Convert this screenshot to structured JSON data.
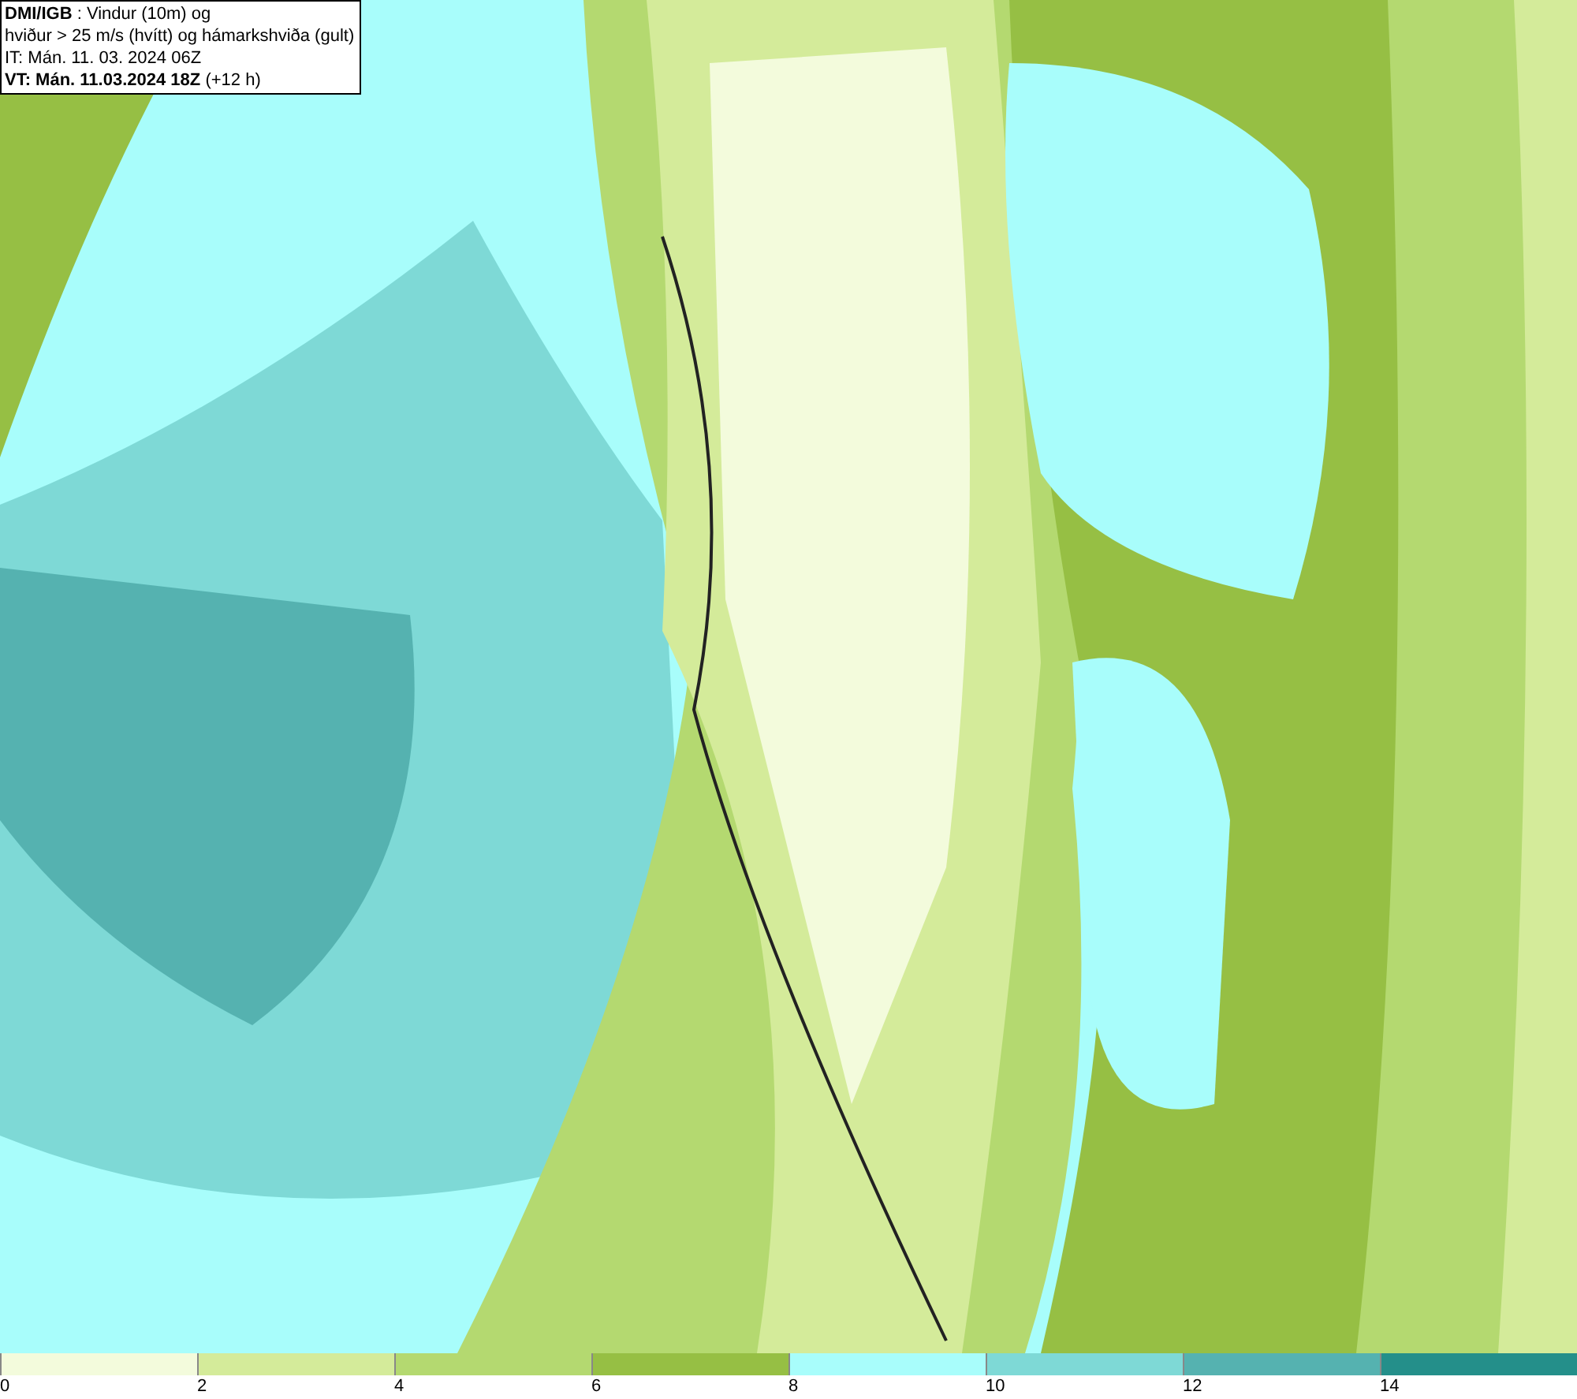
{
  "title_box": {
    "lines": [
      "**DMI/IGB** : Vindur (10m) og",
      "hviður > 25 m/s (hvítt) og hámarkshviða (gult)",
      "IT: Mán. 11. 03. 2024 06Z",
      "**VT: Mán. 11.03.2024 18Z** (+12 h)"
    ]
  },
  "legend": [
    {
      "label": "0",
      "color": "#f3fbdc"
    },
    {
      "label": "2",
      "color": "#d4eb9a"
    },
    {
      "label": "4",
      "color": "#b4d970"
    },
    {
      "label": "6",
      "color": "#96bf44"
    },
    {
      "label": "8",
      "color": "#a8fdfb"
    },
    {
      "label": "10",
      "color": "#7ed9d6"
    },
    {
      "label": "12",
      "color": "#55b2b0"
    },
    {
      "label": "14",
      "color": "#248f8a"
    }
  ]
}
